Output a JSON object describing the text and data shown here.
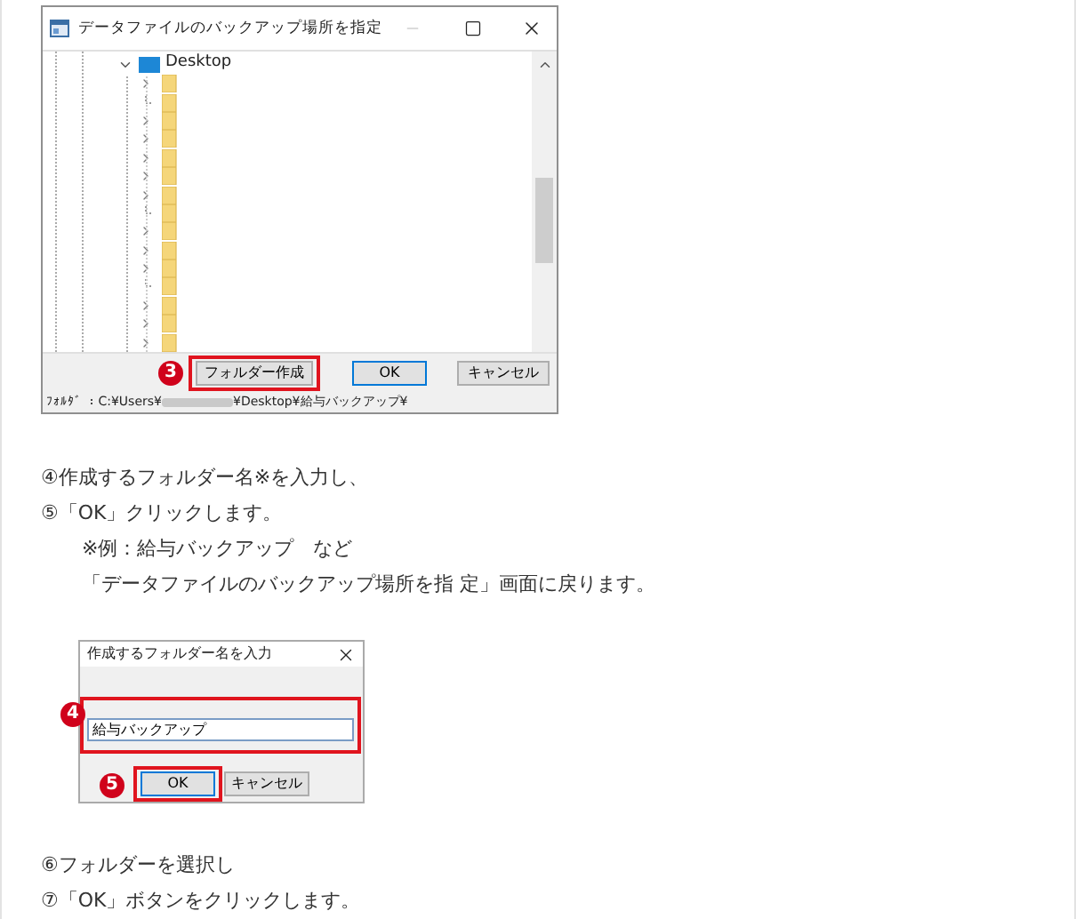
{
  "folder_dialog": {
    "title": "データファイルのバックアップ場所を指定",
    "tree": {
      "label": "Desktop",
      "expanded": true,
      "children": [
        {
          "expandable": true
        },
        {
          "expandable": false
        },
        {
          "expandable": true
        },
        {
          "expandable": true
        },
        {
          "expandable": true
        },
        {
          "expandable": true
        },
        {
          "expandable": true
        },
        {
          "expandable": false
        },
        {
          "expandable": true
        },
        {
          "expandable": true
        },
        {
          "expandable": true
        },
        {
          "expandable": false
        },
        {
          "expandable": true
        },
        {
          "expandable": true
        },
        {
          "expandable": true
        }
      ]
    },
    "buttons": [
      {
        "label": "フォルダー作成",
        "kind": "normal",
        "highlighted": true,
        "badge": "3"
      },
      {
        "label": "OK",
        "kind": "default",
        "highlighted": false
      },
      {
        "label": "キャンセル",
        "kind": "normal",
        "highlighted": false
      }
    ],
    "status": {
      "before_blur": "ﾌｫﾙﾀﾞ ：C:¥Users¥",
      "after_blur": "¥Desktop¥給与バックアップ¥"
    }
  },
  "instructions_1": [
    {
      "text": "④作成するフォルダー名※を入力し、",
      "indented": false
    },
    {
      "text": "⑤「OK」クリックします。",
      "indented": false
    },
    {
      "text": "※例：給与バックアップ　など",
      "indented": true
    },
    {
      "text": "「データファイルのバックアップ場所を指 定」画面に戻ります。",
      "indented": true
    }
  ],
  "name_dialog": {
    "title": "作成するフォルダー名を入力",
    "input": {
      "value": "給与バックアップ",
      "highlighted": true,
      "badge": "4"
    },
    "buttons": [
      {
        "label": "OK",
        "kind": "default",
        "highlighted": true,
        "badge": "5"
      },
      {
        "label": "キャンセル",
        "kind": "normal",
        "highlighted": false
      }
    ]
  },
  "instructions_2": [
    {
      "text": "⑥フォルダーを選択し",
      "indented": false
    },
    {
      "text": "⑦「OK」ボタンをクリックします。",
      "indented": false
    }
  ]
}
